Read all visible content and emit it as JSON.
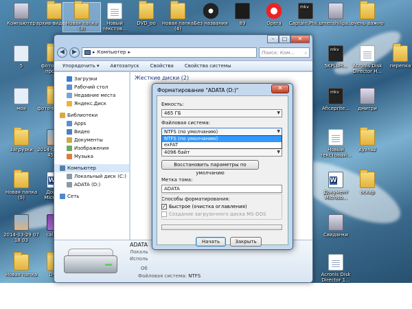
{
  "desktop_icons": [
    {
      "label": "Компьютер",
      "type": "screen"
    },
    {
      "label": "архив-видео...",
      "type": "folder"
    },
    {
      "label": "Новая папка (3)",
      "type": "folder"
    },
    {
      "label": "Новый текстов...",
      "type": "doc"
    },
    {
      "label": "DVD_oo",
      "type": "folder"
    },
    {
      "label": "Новая папка (4)",
      "type": "folder"
    },
    {
      "label": "Без названия",
      "type": "cd"
    },
    {
      "label": "89",
      "type": "dark"
    },
    {
      "label": "Opera",
      "type": "opera"
    },
    {
      "label": "Captain.Phil...",
      "type": "mkv"
    },
    {
      "label": "umenshilipa...",
      "type": "screen"
    },
    {
      "label": "очень важно",
      "type": "folder"
    },
    {
      "label": "5",
      "type": "mp3"
    },
    {
      "label": "фото дети проект",
      "type": "folder"
    },
    {
      "label": "моя",
      "type": "mp3"
    },
    {
      "label": "фото-видео...",
      "type": "folder"
    },
    {
      "label": "Загрузки",
      "type": "folder"
    },
    {
      "label": "2014-03-2909 45 45",
      "type": "photo"
    },
    {
      "label": "Новая папка (5)",
      "type": "folder"
    },
    {
      "label": "Докум Micros...",
      "type": "word"
    },
    {
      "label": "2014-03-29 07 18 03",
      "type": "photo"
    },
    {
      "label": "Новая папка",
      "type": "folder"
    },
    {
      "label": "DVD",
      "type": "folder"
    },
    {
      "label": "calibre",
      "type": "purple"
    },
    {
      "label": "5KPLuH...",
      "type": "mkv"
    },
    {
      "label": "Acronis Disk Director H...",
      "type": "doc"
    },
    {
      "label": "перепка",
      "type": "folder"
    },
    {
      "label": "Aficeprite...",
      "type": "mkv"
    },
    {
      "label": "дмитри",
      "type": "screen"
    },
    {
      "label": "Новый текстовый...",
      "type": "doc"
    },
    {
      "label": "дуэль2",
      "type": "folder"
    },
    {
      "label": "Документ Microso...",
      "type": "word"
    },
    {
      "label": "оскар",
      "type": "folder"
    },
    {
      "label": "Свиданки",
      "type": "screen"
    },
    {
      "label": "Acronis Disk Director 1...",
      "type": "doc"
    }
  ],
  "explorer": {
    "address": "Компьютер",
    "search_placeholder": "Поиск: Ком...",
    "commands": [
      "Упорядочить ▾",
      "Автозапуск",
      "Свойства",
      "Свойства системы"
    ],
    "nav_items": [
      {
        "label": "Загрузки",
        "group": false
      },
      {
        "label": "Рабочий стол",
        "group": false
      },
      {
        "label": "Недавние места",
        "group": false
      },
      {
        "label": "Яндекс.Диск",
        "group": false
      },
      {
        "label": "Библиотеки",
        "group": true
      },
      {
        "label": "Apps",
        "group": false
      },
      {
        "label": "Видео",
        "group": false
      },
      {
        "label": "Документы",
        "group": false
      },
      {
        "label": "Изображения",
        "group": false
      },
      {
        "label": "Музыка",
        "group": false
      },
      {
        "label": "Компьютер",
        "group": true,
        "selected": true
      },
      {
        "label": "Локальный диск (C:)",
        "group": false
      },
      {
        "label": "ADATA (D:)",
        "group": false
      },
      {
        "label": "Сеть",
        "group": true
      }
    ],
    "section_title": "Жесткие диски (2)",
    "details": {
      "name": "ADATA",
      "line2": "Локаль",
      "line3": "Исполь",
      "line4": "Об",
      "fs_label": "Файловая система:",
      "fs_value": "NTFS"
    }
  },
  "dialog": {
    "title": "Форматирование \"ADATA (D:)\"",
    "capacity_label": "Емкость:",
    "capacity_value": "465 ГБ",
    "fs_label": "Файловая система:",
    "fs_value": "NTFS (по умолчанию)",
    "fs_options": [
      "NTFS (по умолчанию)",
      "exFAT"
    ],
    "cluster_value": "4096 байт",
    "restore_button": "Восстановить параметры по умолчанию",
    "volume_label": "Метка тома:",
    "volume_value": "ADATA",
    "format_options_label": "Способы форматирования:",
    "quick_format": "Быстрое (очистка оглавления)",
    "quick_format_checked": true,
    "msdos_disk": "Создание загрузочного диска MS-DOS",
    "msdos_checked": false,
    "start_button": "Начать",
    "close_button": "Закрыть"
  }
}
